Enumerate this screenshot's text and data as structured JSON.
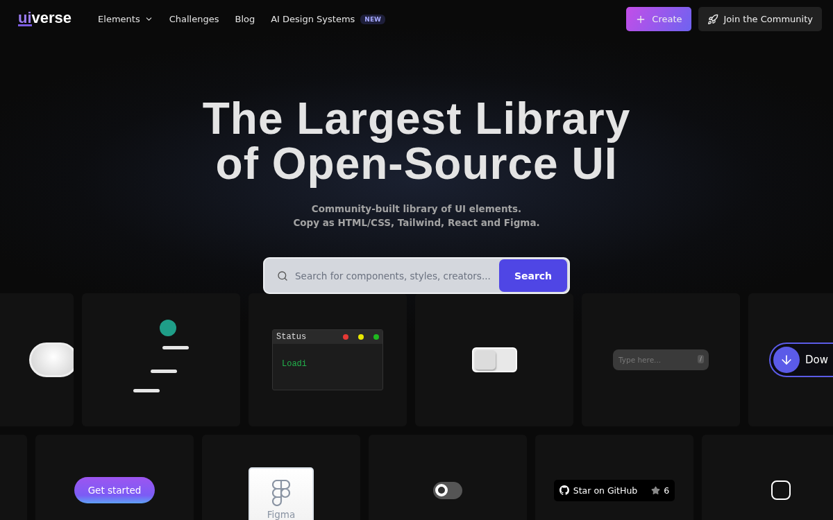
{
  "nav": {
    "logo_accent": "ui",
    "logo_rest": "verse",
    "links": [
      {
        "label": "Elements",
        "kind": "dropdown"
      },
      {
        "label": "Challenges",
        "kind": "link"
      },
      {
        "label": "Blog",
        "kind": "link"
      },
      {
        "label": "AI Design Systems",
        "kind": "link",
        "badge": "NEW"
      }
    ],
    "create_button": "Create",
    "community_button": "Join the Community"
  },
  "hero": {
    "title_lines": [
      "The Largest Library",
      "of Open-Source UI"
    ],
    "subtitle_lines": [
      "Community-built library of UI elements.",
      "Copy as HTML/CSS, Tailwind, React and Figma."
    ]
  },
  "search": {
    "placeholder": "Search for components, styles, creators...",
    "button": "Search"
  },
  "rows": [
    [
      {
        "kind": "pill"
      },
      {
        "kind": "loader"
      },
      {
        "kind": "status",
        "title": "Status",
        "text": "Loadi"
      },
      {
        "kind": "neuswitch",
        "on": false
      },
      {
        "kind": "keyinput",
        "placeholder": "Type here...",
        "key": "/"
      },
      {
        "kind": "download",
        "label": "Dow"
      }
    ],
    [
      {
        "kind": "empty"
      },
      {
        "kind": "gradient",
        "label": "Get started"
      },
      {
        "kind": "figma",
        "label": "Figma"
      },
      {
        "kind": "toggle",
        "on": false
      },
      {
        "kind": "github",
        "label": "Star on GitHub",
        "count": "6"
      },
      {
        "kind": "checkbox",
        "checked": false
      }
    ]
  ]
}
